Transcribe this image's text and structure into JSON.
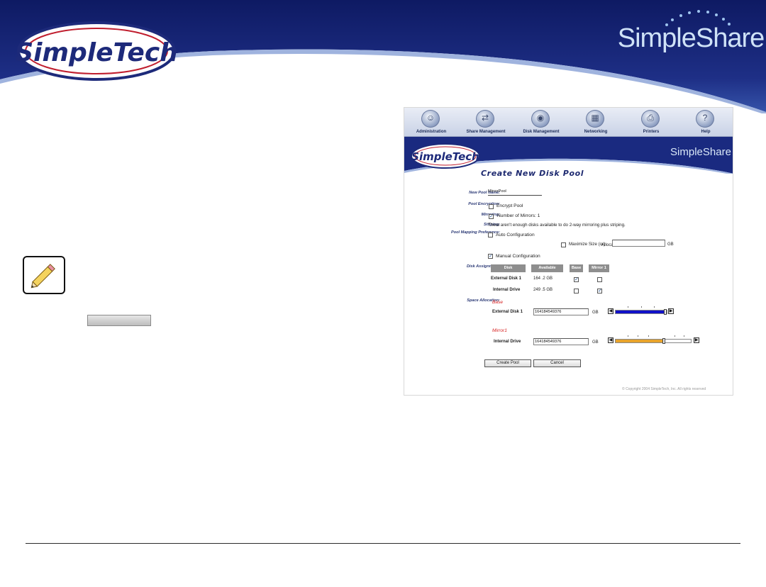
{
  "header": {
    "left_logo_text": "SimpleTech",
    "right_logo_text": "SimpleShare",
    "colors": {
      "navy": "#1d2a7a",
      "blue_light": "#3c65bf",
      "logo_red": "#c01e2e"
    }
  },
  "note_icon": "pencil-note-icon",
  "screenshot": {
    "toolbar": [
      {
        "label": "Administration",
        "icon": "admin-icon",
        "glyph": "☺"
      },
      {
        "label": "Share Management",
        "icon": "share-icon",
        "glyph": "⇄"
      },
      {
        "label": "Disk Management",
        "icon": "disk-icon",
        "glyph": "◉"
      },
      {
        "label": "Networking",
        "icon": "network-icon",
        "glyph": "▦"
      },
      {
        "label": "Printers",
        "icon": "printer-icon",
        "glyph": "⎙"
      },
      {
        "label": "Help",
        "icon": "help-icon",
        "glyph": "?"
      }
    ],
    "inner_left_logo": "SimpleTech",
    "inner_right_logo": "SimpleShare",
    "title": "Create New Disk Pool",
    "form": {
      "pool_name_label": "New Pool Name:",
      "pool_name_value": "MirrorPool",
      "encryption_label": "Pool Encryption:",
      "encrypt_option": "Encrypt Pool",
      "mirroring_label": "Mirroring:",
      "mirrors_text": "Number of Mirrors:  1",
      "striping_label": "Striping:",
      "striping_text": "There aren't enough disks available to do 2-way mirroring plus striping.",
      "mapping_label": "Pool Mapping Preference:",
      "auto_config": "Auto Configuration",
      "maximize_size": "Maximize Size (or)",
      "allocate_label": "Allocate",
      "gb_unit": "GB",
      "manual_config": "Manual Configuration",
      "disk_assignment_label": "Disk Assignment:",
      "table_headers": {
        "disk": "Disk",
        "available": "Available",
        "base": "Base",
        "mirror": "Mirror 1"
      },
      "rows": [
        {
          "disk": "External Disk 1",
          "available": "164 .2  GB",
          "base": true,
          "mirror": false
        },
        {
          "disk": "Internal Drive",
          "available": "249 .5  GB",
          "base": false,
          "mirror": true
        }
      ],
      "space_allocation_label": "Space Allocation:",
      "base_heading": "Base",
      "base_disk": "External Disk 1",
      "base_value": "164184549376",
      "base_slider_fill": 1.0,
      "base_slider_color": "#1010c8",
      "mirror_heading": "Mirror1",
      "mirror_disk": "Internal Drive",
      "mirror_value": "164184549376",
      "mirror_slider_fill": 0.66,
      "mirror_slider_color": "#e8a42c",
      "create_button": "Create Pool",
      "cancel_button": "Cancel"
    },
    "copyright": "© Copyright 2004 SimpleTech, Inc.  All rights reserved"
  }
}
